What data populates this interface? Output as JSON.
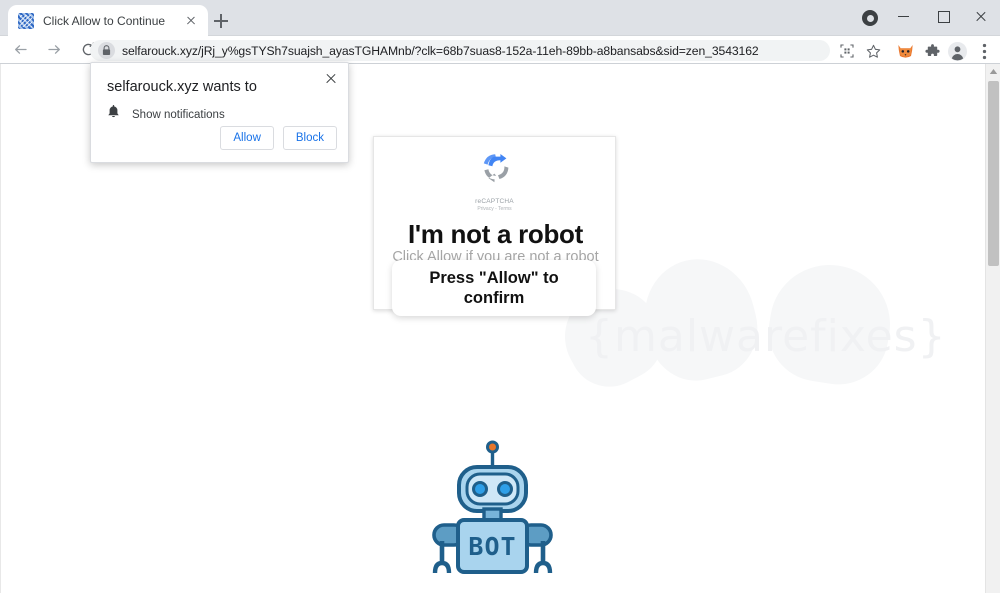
{
  "window": {
    "controls": {
      "profile_icon": "profile-circle-icon",
      "minimize": "minimize-icon",
      "maximize": "maximize-icon",
      "close": "close-icon"
    }
  },
  "tabstrip": {
    "tabs": [
      {
        "title": "Click Allow to Continue",
        "favicon": "site-favicon"
      }
    ],
    "new_tab_label": "+"
  },
  "toolbar": {
    "back_icon": "back-arrow-icon",
    "forward_icon": "forward-arrow-icon",
    "reload_icon": "reload-icon",
    "lock_icon": "lock-icon",
    "url": "selfarouck.xyz/jRj_y%gsTYSh7suajsh_ayasTGHAMnb/?clk=68b7suas8-152a-11eh-89bb-a8bansabs&sid=zen_3543162",
    "icons": [
      {
        "name": "qr-code-icon"
      },
      {
        "name": "bookmark-star-icon"
      },
      {
        "name": "fox-extension-icon",
        "color": "#e8722a"
      },
      {
        "name": "puzzle-extensions-icon"
      },
      {
        "name": "profile-avatar-icon"
      },
      {
        "name": "three-dot-menu-icon"
      }
    ]
  },
  "notification_prompt": {
    "title": "selfarouck.xyz wants to",
    "permission_icon": "bell-icon",
    "permission_label": "Show notifications",
    "allow_label": "Allow",
    "block_label": "Block",
    "close_icon": "close-icon",
    "accent_color": "#1a73e8"
  },
  "page": {
    "recaptcha_card": {
      "logo_icon": "recaptcha-logo-icon",
      "logo_label": "reCAPTCHA",
      "logo_legal": "Privacy - Terms",
      "heading": "I'm not a robot",
      "subheading": "Click Allow if you are not a robot"
    },
    "overlay_box": {
      "line1": "Press \"Allow\" to",
      "line2": "confirm"
    },
    "robot_image": {
      "name": "bot-robot-illustration",
      "body_label": "BOT",
      "primary_color": "#1f5f8b",
      "fill_color": "#a9d4ee"
    },
    "watermark": {
      "text": "{malwarefixes}",
      "color": "#f0f1f3"
    }
  },
  "scrollbar": {
    "up_arrow_icon": "scroll-up-arrow-icon",
    "thumb": "scrollbar-thumb"
  }
}
